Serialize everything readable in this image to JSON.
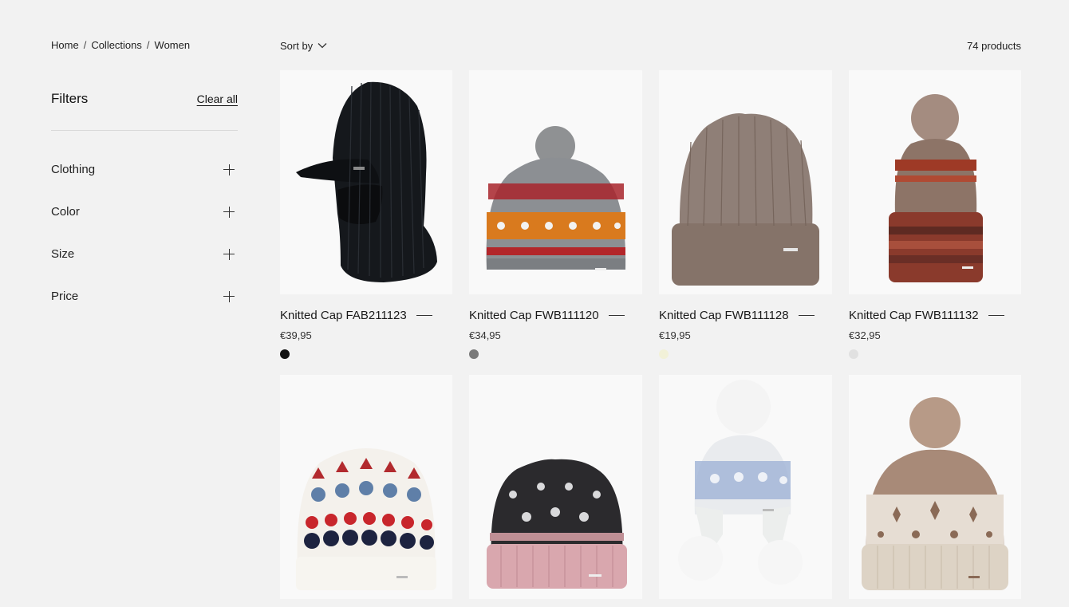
{
  "breadcrumb": [
    {
      "label": "Home"
    },
    {
      "label": "Collections"
    },
    {
      "label": "Women"
    }
  ],
  "filters": {
    "title": "Filters",
    "clear_all": "Clear all",
    "groups": [
      {
        "label": "Clothing"
      },
      {
        "label": "Color"
      },
      {
        "label": "Size"
      },
      {
        "label": "Price"
      }
    ]
  },
  "toolbar": {
    "sort_label": "Sort by",
    "count": "74 products"
  },
  "products": [
    {
      "title": "Knitted Cap FAB211123",
      "price": "€39,95",
      "swatch": "#111111"
    },
    {
      "title": "Knitted Cap FWB111120",
      "price": "€34,95",
      "swatch": "#7a7a7a"
    },
    {
      "title": "Knitted Cap FWB111128",
      "price": "€19,95",
      "swatch": "#f2f1d8"
    },
    {
      "title": "Knitted Cap FWB111132",
      "price": "€32,95",
      "swatch": "#e1e1e1"
    },
    {
      "title": "",
      "price": "",
      "swatch": ""
    },
    {
      "title": "",
      "price": "",
      "swatch": ""
    },
    {
      "title": "",
      "price": "",
      "swatch": ""
    },
    {
      "title": "",
      "price": "",
      "swatch": ""
    }
  ]
}
